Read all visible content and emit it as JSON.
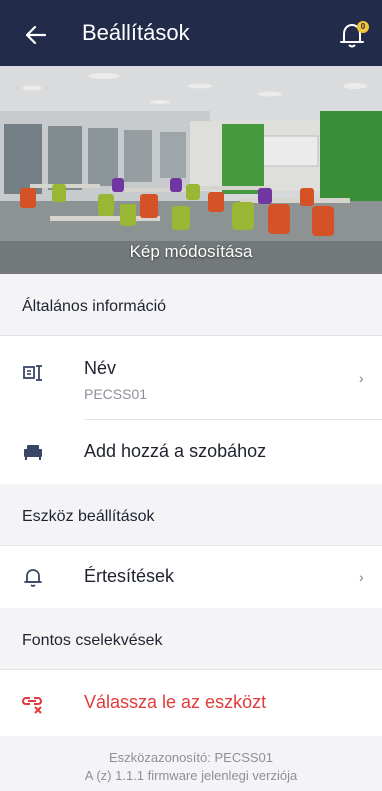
{
  "header": {
    "title": "Beállítások",
    "back_icon": "arrow-left-icon",
    "notification_icon": "bell-icon",
    "notification_badge": "0",
    "bg_color": "#232b4a"
  },
  "hero": {
    "caption": "Kép módosítása"
  },
  "sections": {
    "general": {
      "title": "Általános információ",
      "name_row": {
        "label": "Név",
        "value": "PECSS01",
        "icon": "device-id-icon"
      },
      "room_row": {
        "label": "Add hozzá a szobához",
        "icon": "sofa-icon"
      }
    },
    "device": {
      "title": "Eszköz beállítások",
      "notifications_row": {
        "label": "Értesítések",
        "icon": "bell-outline-icon"
      }
    },
    "actions": {
      "title": "Fontos cselekvések",
      "unlink_row": {
        "label": "Válassza le az eszközt",
        "icon": "unlink-icon",
        "color": "#e23b3b"
      }
    }
  },
  "footer": {
    "device_id": "Eszközazonosító: PECSS01",
    "firmware": "A (z) 1.1.1 firmware jelenlegi verziója"
  }
}
